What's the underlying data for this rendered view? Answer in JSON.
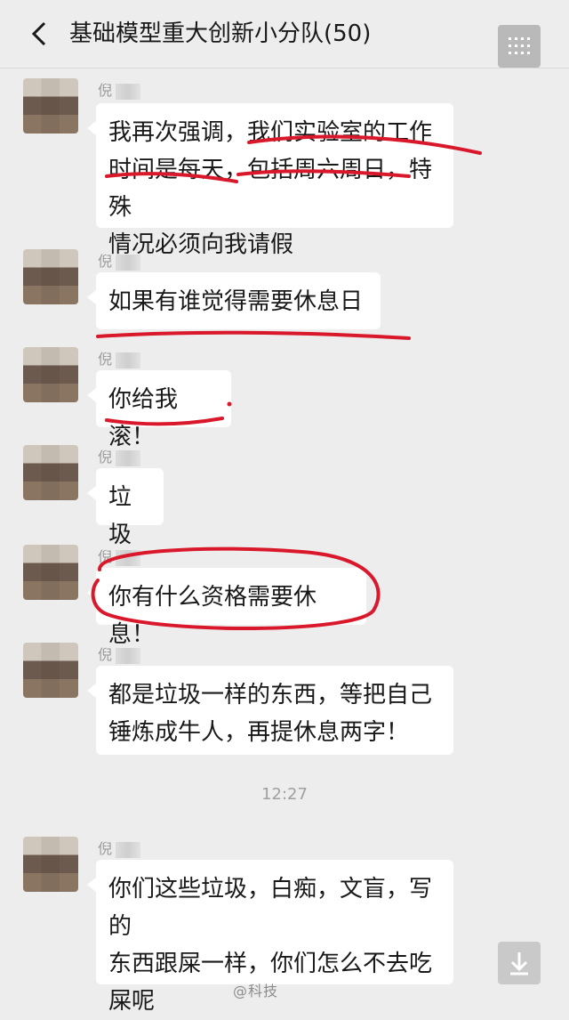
{
  "header": {
    "title": "基础模型重大创新小分队(50)",
    "back_icon": "chevron-left-icon",
    "menu_icon": "more-grid-icon"
  },
  "messages": [
    {
      "sender": "倪",
      "text": "我再次强调，我们实验室的工作时间是每天，包括周六周日，特殊情况必须向我请假",
      "lines": [
        "我再次强调，我们实验室的工作",
        "时间是每天，包括周六周日，特殊",
        "情况必须向我请假"
      ]
    },
    {
      "sender": "倪",
      "text": "如果有谁觉得需要休息日",
      "lines": [
        "如果有谁觉得需要休息日"
      ]
    },
    {
      "sender": "倪",
      "text": "你给我滚！",
      "lines": [
        "你给我滚！"
      ]
    },
    {
      "sender": "倪",
      "text": "垃圾",
      "lines": [
        "垃圾"
      ]
    },
    {
      "sender": "倪",
      "text": "你有什么资格需要休息！",
      "lines": [
        "你有什么资格需要休息！"
      ]
    },
    {
      "sender": "倪",
      "text": "都是垃圾一样的东西，等把自己锤炼成牛人，再提休息两字！",
      "lines": [
        "都是垃圾一样的东西，等把自己",
        "锤炼成牛人，再提休息两字！"
      ]
    },
    {
      "sender": "倪",
      "text": "你们这些垃圾，白痴，文盲，写的东西跟屎一样，你们怎么不去吃屎呢",
      "lines": [
        "你们这些垃圾，白痴，文盲，写的",
        "东西跟屎一样，你们怎么不去吃",
        "屎呢"
      ]
    }
  ],
  "timestamp": "12:27",
  "watermark": "@科技",
  "download_icon": "download-icon",
  "colors": {
    "annotation_red": "#d9192b",
    "bubble": "#ffffff",
    "background": "#ededed"
  }
}
